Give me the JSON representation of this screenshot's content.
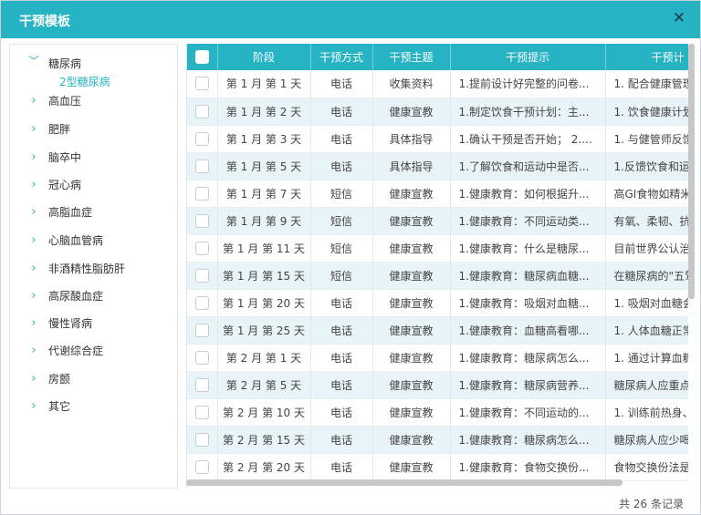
{
  "dialog": {
    "title": "干预模板",
    "close_icon": "close-icon"
  },
  "tree": {
    "items": [
      {
        "label": "糖尿病",
        "expanded": true
      },
      {
        "label": "高血压",
        "expanded": false
      },
      {
        "label": "肥胖",
        "expanded": false
      },
      {
        "label": "脑卒中",
        "expanded": false
      },
      {
        "label": "冠心病",
        "expanded": false
      },
      {
        "label": "高脂血症",
        "expanded": false
      },
      {
        "label": "心脑血管病",
        "expanded": false
      },
      {
        "label": "非酒精性脂肪肝",
        "expanded": false
      },
      {
        "label": "高尿酸血症",
        "expanded": false
      },
      {
        "label": "慢性肾病",
        "expanded": false
      },
      {
        "label": "代谢综合症",
        "expanded": false
      },
      {
        "label": "房颤",
        "expanded": false
      },
      {
        "label": "其它",
        "expanded": false
      }
    ],
    "child": "2型糖尿病"
  },
  "table": {
    "headers": [
      "阶段",
      "干预方式",
      "干预主题",
      "干预提示",
      "干预计"
    ],
    "rows": [
      [
        "第 1 月 第 1 天",
        "电话",
        "收集资料",
        "1.提前设计好完整的问卷...",
        "1. 配合健康管理"
      ],
      [
        "第 1 月 第 2 天",
        "电话",
        "健康宣教",
        "1.制定饮食干预计划：主...",
        "1. 饮食健康计划"
      ],
      [
        "第 1 月 第 3 天",
        "电话",
        "具体指导",
        "1.确认干预是否开始； 2....",
        "1. 与健管师反馈"
      ],
      [
        "第 1 月 第 5 天",
        "电话",
        "具体指导",
        "1.了解饮食和运动中是否...",
        "1.反馈饮食和运"
      ],
      [
        "第 1 月 第 7 天",
        "短信",
        "健康宣教",
        "1.健康教育：如何根据升...",
        "高GI食物如精米"
      ],
      [
        "第 1 月 第 9 天",
        "短信",
        "健康宣教",
        "1.健康教育：不同运动类...",
        "有氧、柔韧、抗"
      ],
      [
        "第 1 月 第 11 天",
        "短信",
        "健康宣教",
        "1.健康教育：什么是糖尿...",
        "目前世界公认治"
      ],
      [
        "第 1 月 第 15 天",
        "短信",
        "健康宣教",
        "1.健康教育：糖尿病血糖...",
        "在糖尿病的\"五驾"
      ],
      [
        "第 1 月 第 20 天",
        "电话",
        "健康宣教",
        "1.健康教育：吸烟对血糖...",
        "1. 吸烟对血糖会"
      ],
      [
        "第 1 月 第 25 天",
        "电话",
        "健康宣教",
        "1.健康教育：血糖高看哪...",
        "1. 人体血糖正常"
      ],
      [
        "第 2 月 第 1 天",
        "电话",
        "健康宣教",
        "1.健康教育：糖尿病怎么...",
        "1. 通过计算血糖"
      ],
      [
        "第 2 月 第 5 天",
        "电话",
        "健康宣教",
        "1.健康教育：糖尿病营养...",
        "糖尿病人应重点"
      ],
      [
        "第 2 月 第 10 天",
        "电话",
        "健康宣教",
        "1.健康教育：不同运动的...",
        "1. 训练前热身、"
      ],
      [
        "第 2 月 第 15 天",
        "电话",
        "健康宣教",
        "1.健康教育：糖尿病怎么...",
        "糖尿病人应少喝"
      ],
      [
        "第 2 月 第 20 天",
        "电话",
        "健康宣教",
        "1.健康教育：食物交换份...",
        "食物交换份法是"
      ]
    ]
  },
  "footer": {
    "total": "共 26 条记录"
  },
  "colors": {
    "accent": "#26b3c4",
    "alt_row": "#e9f4f8"
  }
}
